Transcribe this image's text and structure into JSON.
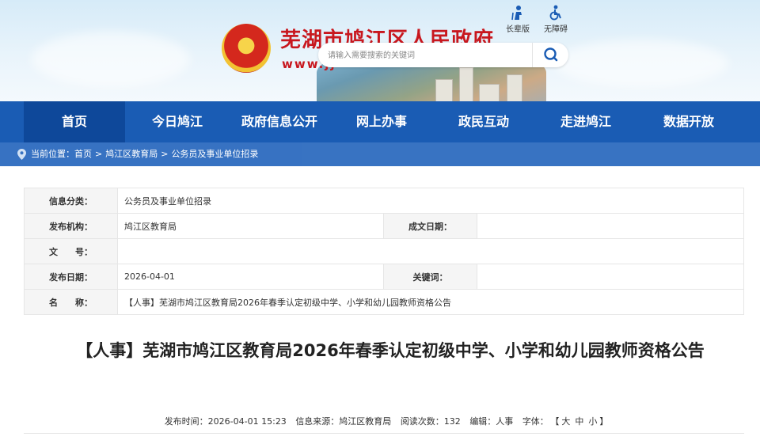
{
  "header": {
    "site_title": "芜湖市鸠江区人民政府",
    "site_url": "www.jj",
    "search_placeholder": "请输入需要搜索的关键词",
    "tools": [
      {
        "label": "长辈版",
        "icon": "elder-icon"
      },
      {
        "label": "无障碍",
        "icon": "accessibility-icon"
      }
    ]
  },
  "nav": {
    "items": [
      "首页",
      "今日鸠江",
      "政府信息公开",
      "网上办事",
      "政民互动",
      "走进鸠江",
      "数据开放"
    ],
    "active_index": 0
  },
  "breadcrumb": {
    "prefix": "当前位置：",
    "items": [
      "首页",
      "鸠江区教育局",
      "公务员及事业单位招录"
    ],
    "separator": ">"
  },
  "meta": {
    "category_label": "信息分类：",
    "category_value": "公务员及事业单位招录",
    "publisher_label": "发布机构：",
    "publisher_value": "鸠江区教育局",
    "written_date_label": "成文日期：",
    "written_date_value": "",
    "doc_no_label": "文　　号：",
    "doc_no_value": "",
    "publish_date_label": "发布日期：",
    "publish_date_value": "2026-04-01",
    "keywords_label": "关键词：",
    "keywords_value": "",
    "name_label": "名　　称：",
    "name_value": "【人事】芜湖市鸠江区教育局2026年春季认定初级中学、小学和幼儿园教师资格公告"
  },
  "article": {
    "title": "【人事】芜湖市鸠江区教育局2026年春季认定初级中学、小学和幼儿园教师资格公告",
    "publish_time": "发布时间：2026-04-01 15:23",
    "source": "信息来源：鸠江区教育局",
    "reads": "阅读次数：132",
    "editor": "编辑：人事",
    "font_label": "字体：",
    "font_open": "【",
    "font_large": "大",
    "font_medium": "中",
    "font_small": "小",
    "font_close": "】"
  },
  "colors": {
    "nav_bg": "#1a5cb4",
    "nav_active": "#0e489a",
    "title_red": "#c8171e"
  }
}
